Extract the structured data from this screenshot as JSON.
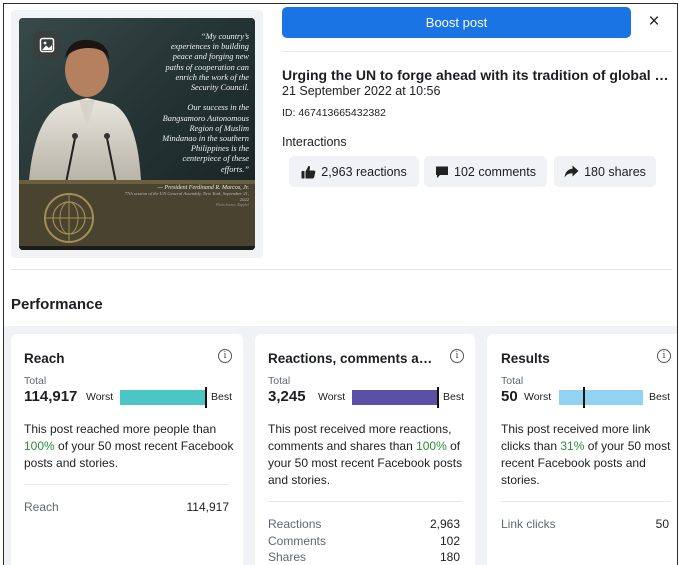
{
  "post": {
    "image_quote": "“My country’s\nexperiences in building\npeace and forging new\npaths of cooperation can\nenrich the work of the\nSecurity Council.\n\nOur success in the\nBangsamoro Autonomous\nRegion of Muslim\nMindanao in the southern\nPhilippines is the\ncenterpiece of these\nefforts.”",
    "image_attribution": "— President Ferdinand R. Marcos, Jr.",
    "image_attribution_detail": "77th session of the UN General Assembly, New York, September 21, 2022",
    "image_credit": "Photo Source: Rappler",
    "title": "Urging the UN to forge ahead with its tradition of global pe…",
    "date": "21 September 2022 at 10:56",
    "id": "ID: 467413665432382"
  },
  "toolbar": {
    "boost_label": "Boost post",
    "close_label": "×"
  },
  "interactions": {
    "label": "Interactions",
    "reactions": "2,963 reactions",
    "comments": "102 comments",
    "shares": "180 shares"
  },
  "performance": {
    "title": "Performance",
    "cards": [
      {
        "title": "Reach",
        "total_label": "Total",
        "total_value": "114,917",
        "worst_label": "Worst",
        "best_label": "Best",
        "bar_color": "#4cc5c5",
        "marker_position": 1.0,
        "desc_before": "This post reached more people than ",
        "desc_pct": "100%",
        "desc_after": " of your 50 most recent Facebook posts and stories.",
        "rows": [
          {
            "label": "Reach",
            "value": "114,917"
          }
        ]
      },
      {
        "title": "Reactions, comments a…",
        "total_label": "Total",
        "total_value": "3,245",
        "worst_label": "Worst",
        "best_label": "Best",
        "bar_color": "#5c4fa8",
        "marker_position": 1.0,
        "desc_before": "This post received more reactions, comments and shares than ",
        "desc_pct": "100%",
        "desc_after": " of your 50 most recent Facebook posts and stories.",
        "rows": [
          {
            "label": "Reactions",
            "value": "2,963"
          },
          {
            "label": "Comments",
            "value": "102"
          },
          {
            "label": "Shares",
            "value": "180"
          }
        ]
      },
      {
        "title": "Results",
        "total_label": "Total",
        "total_value": "50",
        "worst_label": "Worst",
        "best_label": "Best",
        "bar_color": "#93d3f2",
        "marker_position": 0.31,
        "desc_before": "This post received more link clicks than ",
        "desc_pct": "31%",
        "desc_after": " of your 50 most recent Facebook posts and stories.",
        "rows": [
          {
            "label": "Link clicks",
            "value": "50"
          }
        ]
      }
    ]
  },
  "colors": {
    "accent": "#1b74e4",
    "positive": "#2e8b3b",
    "panel_bg": "#f0f2f5"
  }
}
